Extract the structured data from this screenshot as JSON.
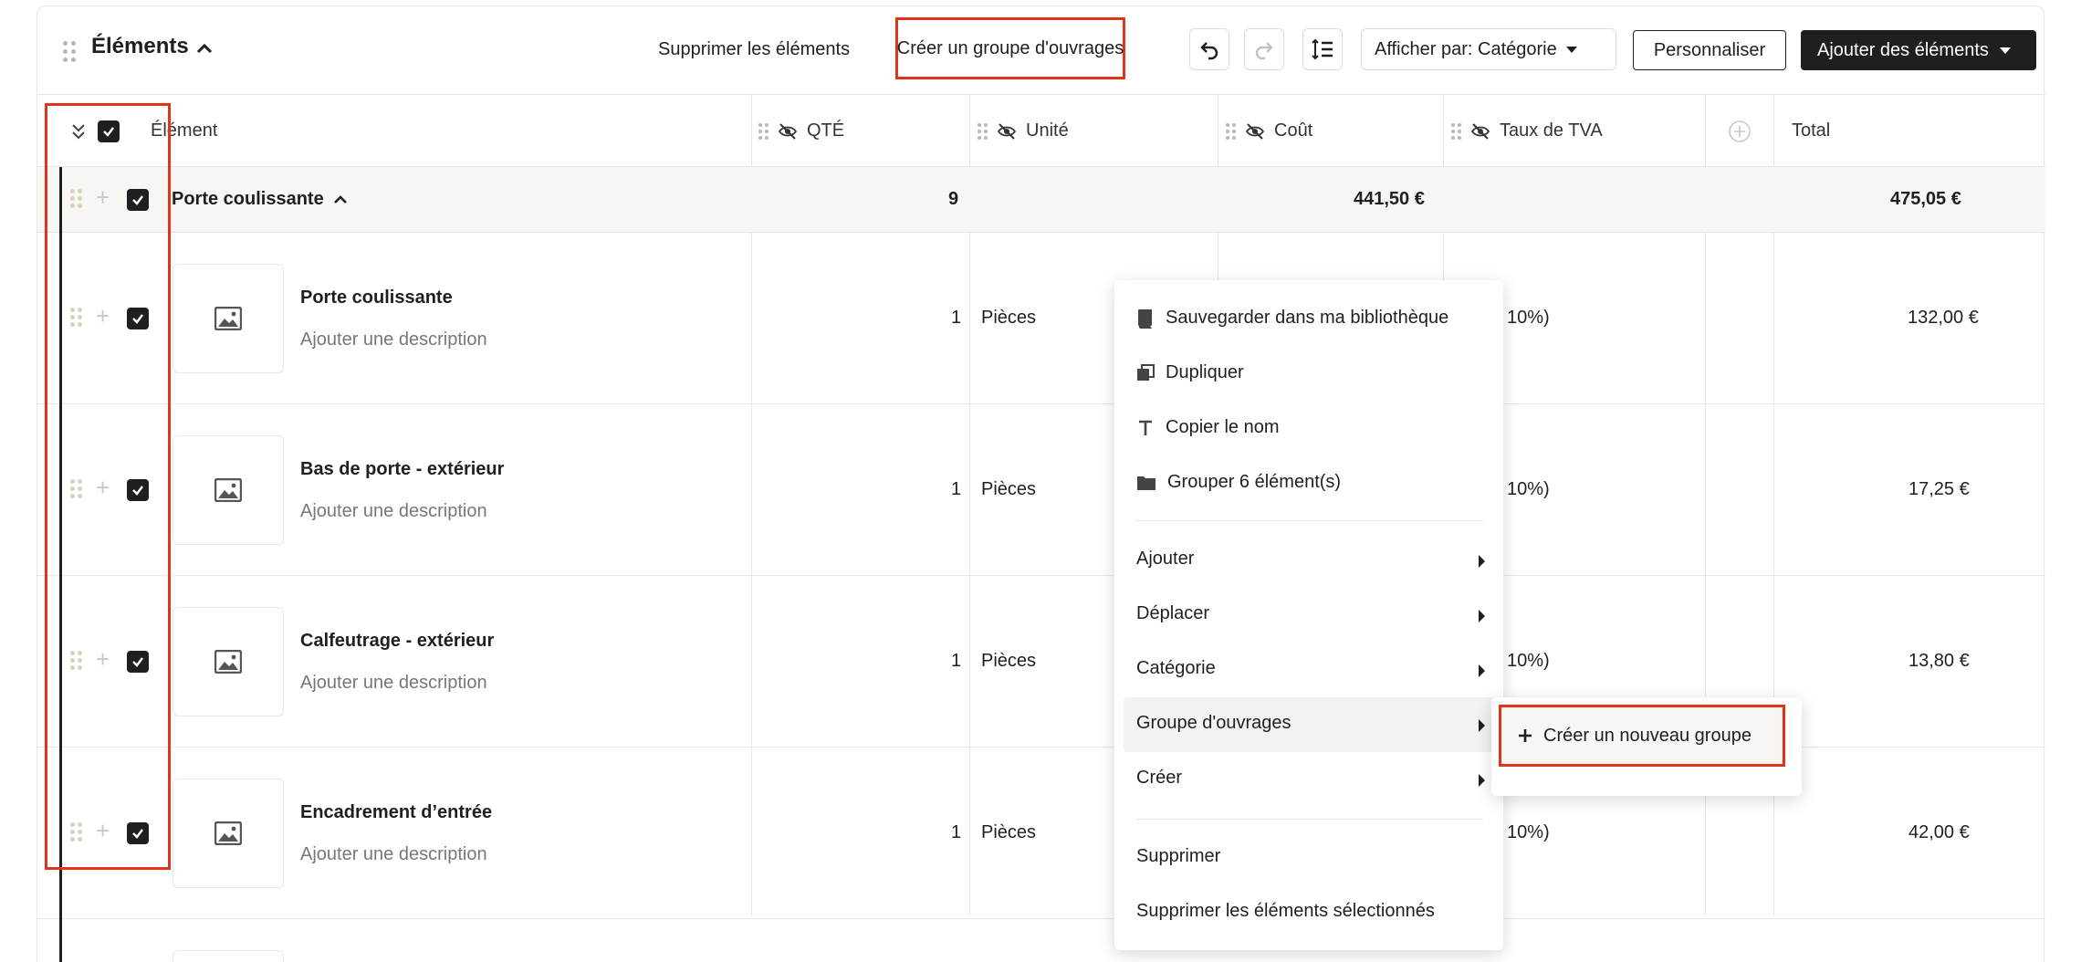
{
  "header": {
    "title": "Éléments",
    "delete_label": "Supprimer les éléments",
    "create_group_label": "Créer un groupe d'ouvrages",
    "display_by_label": "Afficher par: Catégorie",
    "customize_label": "Personnaliser",
    "add_items_label": "Ajouter des éléments"
  },
  "columns": {
    "element": "Élément",
    "qty": "QTÉ",
    "unit": "Unité",
    "cost": "Coût",
    "vat": "Taux de TVA",
    "total": "Total"
  },
  "group": {
    "name": "Porte coulissante",
    "qty": "9",
    "cost": "441,50 €",
    "total": "475,05 €"
  },
  "rows": [
    {
      "name": "Porte coulissante",
      "desc": "Ajouter une description",
      "qty": "1",
      "unit": "Pièces",
      "vat": "10%)",
      "total": "132,00 €"
    },
    {
      "name": "Bas de porte - extérieur",
      "desc": "Ajouter une description",
      "qty": "1",
      "unit": "Pièces",
      "vat": "10%)",
      "total": "17,25 €"
    },
    {
      "name": "Calfeutrage - extérieur",
      "desc": "Ajouter une description",
      "qty": "1",
      "unit": "Pièces",
      "vat": "10%)",
      "total": "13,80 €"
    },
    {
      "name": "Encadrement d’entrée",
      "desc": "Ajouter une description",
      "qty": "1",
      "unit": "Pièces",
      "vat": "10%)",
      "total": "42,00 €"
    }
  ],
  "context_menu": {
    "save_library": "Sauvegarder dans ma bibliothèque",
    "duplicate": "Dupliquer",
    "copy_name": "Copier le nom",
    "group_items": "Grouper 6 élément(s)",
    "add": "Ajouter",
    "move": "Déplacer",
    "category": "Catégorie",
    "work_group": "Groupe d'ouvrages",
    "create": "Créer",
    "delete": "Supprimer",
    "delete_selected": "Supprimer les éléments sélectionnés"
  },
  "submenu": {
    "create_new_group": "Créer un nouveau groupe"
  },
  "colors": {
    "highlight": "#e0341c",
    "dark": "#1f1f1f",
    "group_bg": "#f7f6f3"
  }
}
